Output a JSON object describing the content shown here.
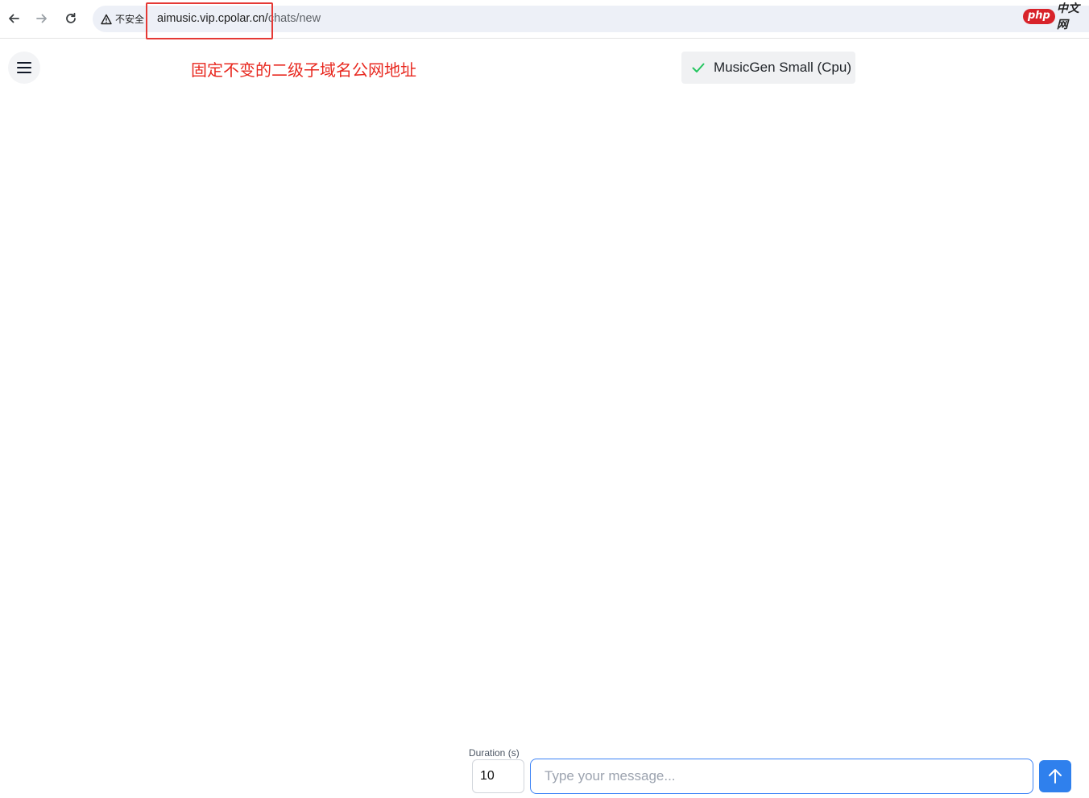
{
  "browser": {
    "security_label": "不安全",
    "url_host": "aimusic.vip.cpolar.cn/",
    "url_path": "chats/new",
    "watermark_badge": "php",
    "watermark_text": "中文网"
  },
  "header": {
    "annotation": "固定不变的二级子域名公网地址",
    "model_name": "MusicGen Small (Cpu)",
    "model_status_icon": "check-icon"
  },
  "composer": {
    "duration_label": "Duration (s)",
    "duration_value": "10",
    "message_placeholder": "Type your message...",
    "send_icon": "arrow-up-icon"
  },
  "colors": {
    "annotation": "#e8281f",
    "highlight_box": "#e53935",
    "accent": "#2f80ed",
    "check": "#22c55e"
  }
}
